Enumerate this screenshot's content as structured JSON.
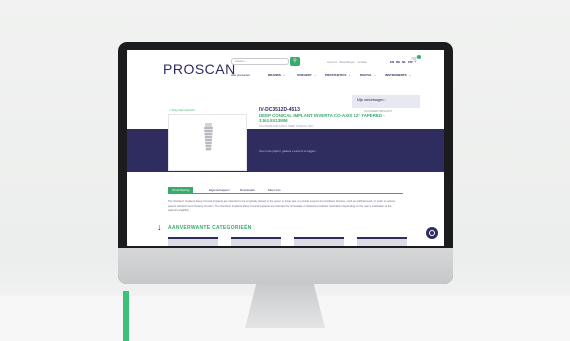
{
  "site": {
    "logo": "PROSCAN",
    "search_placeholder": "Zoeken...",
    "search_icon": "search-icon",
    "top_links": "Account · Bestellingen · Contact",
    "languages": [
      "EN",
      "DE",
      "NL",
      "FR"
    ],
    "cart_icon": "cart-icon"
  },
  "nav": [
    "Alle producten",
    "BRANDS",
    "SURGERY",
    "PROSTHETICS",
    "DIGITAL",
    "INSTRUMENTS"
  ],
  "dropdown": {
    "label": "Mijn winkelwagen",
    "sub": "SOUTHERN IMPLANTS"
  },
  "product": {
    "back_link": "< Terug naar overzicht",
    "sku": "IV-DC3512D-4513",
    "title": "DEEP CONICAL IMPLANT INVERTA CO-AXIS 12° TAPERED - 3.5/4.5X13MM",
    "brand_line": "SOUTHERN IMPLANTS DEEP CONICAL (DC)",
    "login_note": "Voor onze prijzen, gelieve u eerst in te loggen."
  },
  "tabs": [
    "Omschrijving",
    "Eigenschappen",
    "Downloads",
    "Meer info"
  ],
  "description": "The Southern Implants Deep Conical Implants are intended to be surgically placed in the upper or lower jaw, to provide support for prosthetic devices, such as artificial teeth, in order to restore patient esthetics and chewing function. The Southern Implants Deep Conical Implants are intended for immediate or delayed prosthetic restoration depending on the user's evaluation of the patient's eligibility.",
  "related_heading": "AANVERWANTE CATEGORIEËN",
  "colors": {
    "brand_navy": "#2f2c60",
    "accent_green": "#3aaa6a",
    "frame": "#1c1c1e"
  }
}
